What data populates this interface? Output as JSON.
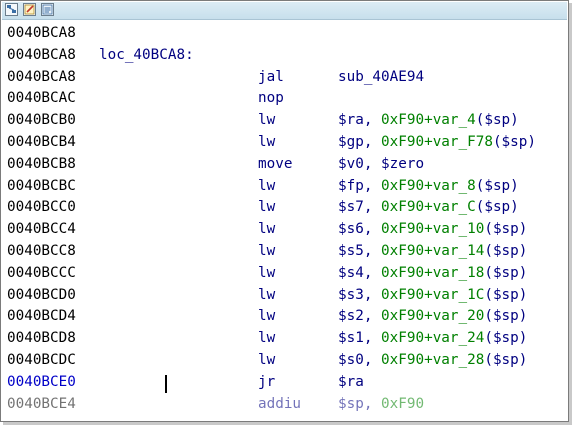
{
  "toolbar": {
    "icons": [
      "graph-view-icon",
      "edit-icon",
      "text-view-icon"
    ]
  },
  "colors": {
    "title_bar": "#c7dfec",
    "address": "#000000",
    "current_address": "#0000c8",
    "mnemonic": "#000080",
    "operand_number": "#008000",
    "operand_var": "#008000"
  },
  "listing": [
    {
      "addr": "0040BCA8",
      "label": "",
      "mn": "",
      "ops": []
    },
    {
      "addr": "0040BCA8",
      "label": "loc_40BCA8:",
      "mn": "",
      "ops": []
    },
    {
      "addr": "0040BCA8",
      "label": "",
      "mn": "jal",
      "ops": [
        {
          "t": "sub_40AE94",
          "c": "p"
        }
      ]
    },
    {
      "addr": "0040BCAC",
      "label": "",
      "mn": "nop",
      "ops": []
    },
    {
      "addr": "0040BCB0",
      "label": "",
      "mn": "lw",
      "ops": [
        {
          "t": "$ra, ",
          "c": "p"
        },
        {
          "t": "0xF90+var_4",
          "c": "g"
        },
        {
          "t": "($sp)",
          "c": "p"
        }
      ]
    },
    {
      "addr": "0040BCB4",
      "label": "",
      "mn": "lw",
      "ops": [
        {
          "t": "$gp, ",
          "c": "p"
        },
        {
          "t": "0xF90+var_F78",
          "c": "g"
        },
        {
          "t": "($sp)",
          "c": "p"
        }
      ]
    },
    {
      "addr": "0040BCB8",
      "label": "",
      "mn": "move",
      "ops": [
        {
          "t": "$v0, $zero",
          "c": "p"
        }
      ]
    },
    {
      "addr": "0040BCBC",
      "label": "",
      "mn": "lw",
      "ops": [
        {
          "t": "$fp, ",
          "c": "p"
        },
        {
          "t": "0xF90+var_8",
          "c": "g"
        },
        {
          "t": "($sp)",
          "c": "p"
        }
      ]
    },
    {
      "addr": "0040BCC0",
      "label": "",
      "mn": "lw",
      "ops": [
        {
          "t": "$s7, ",
          "c": "p"
        },
        {
          "t": "0xF90+var_C",
          "c": "g"
        },
        {
          "t": "($sp)",
          "c": "p"
        }
      ]
    },
    {
      "addr": "0040BCC4",
      "label": "",
      "mn": "lw",
      "ops": [
        {
          "t": "$s6, ",
          "c": "p"
        },
        {
          "t": "0xF90+var_10",
          "c": "g"
        },
        {
          "t": "($sp)",
          "c": "p"
        }
      ]
    },
    {
      "addr": "0040BCC8",
      "label": "",
      "mn": "lw",
      "ops": [
        {
          "t": "$s5, ",
          "c": "p"
        },
        {
          "t": "0xF90+var_14",
          "c": "g"
        },
        {
          "t": "($sp)",
          "c": "p"
        }
      ]
    },
    {
      "addr": "0040BCCC",
      "label": "",
      "mn": "lw",
      "ops": [
        {
          "t": "$s4, ",
          "c": "p"
        },
        {
          "t": "0xF90+var_18",
          "c": "g"
        },
        {
          "t": "($sp)",
          "c": "p"
        }
      ]
    },
    {
      "addr": "0040BCD0",
      "label": "",
      "mn": "lw",
      "ops": [
        {
          "t": "$s3, ",
          "c": "p"
        },
        {
          "t": "0xF90+var_1C",
          "c": "g"
        },
        {
          "t": "($sp)",
          "c": "p"
        }
      ]
    },
    {
      "addr": "0040BCD4",
      "label": "",
      "mn": "lw",
      "ops": [
        {
          "t": "$s2, ",
          "c": "p"
        },
        {
          "t": "0xF90+var_20",
          "c": "g"
        },
        {
          "t": "($sp)",
          "c": "p"
        }
      ]
    },
    {
      "addr": "0040BCD8",
      "label": "",
      "mn": "lw",
      "ops": [
        {
          "t": "$s1, ",
          "c": "p"
        },
        {
          "t": "0xF90+var_24",
          "c": "g"
        },
        {
          "t": "($sp)",
          "c": "p"
        }
      ]
    },
    {
      "addr": "0040BCDC",
      "label": "",
      "mn": "lw",
      "ops": [
        {
          "t": "$s0, ",
          "c": "p"
        },
        {
          "t": "0xF90+var_28",
          "c": "g"
        },
        {
          "t": "($sp)",
          "c": "p"
        }
      ]
    },
    {
      "addr": "0040BCE0",
      "label": "",
      "mn": "jr",
      "ops": [
        {
          "t": "$ra",
          "c": "p"
        }
      ],
      "current": true
    },
    {
      "addr": "0040BCE4",
      "label": "",
      "mn": "addiu",
      "ops": [
        {
          "t": "$sp, ",
          "c": "p"
        },
        {
          "t": "0xF90",
          "c": "g"
        }
      ]
    }
  ]
}
